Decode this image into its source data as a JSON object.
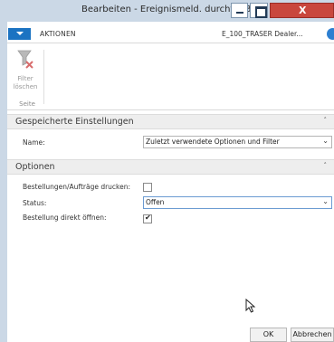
{
  "window": {
    "title": "Bearbeiten - Ereignismeld. durchf. - Best.",
    "close_glyph": "X"
  },
  "ribbon": {
    "tab_label": "AKTIONEN",
    "company": "E_100_TRASER Dealer...",
    "filter_button_label_line1": "Filter",
    "filter_button_label_line2": "löschen",
    "group_label": "Seite"
  },
  "sections": {
    "saved_settings": {
      "title": "Gespeicherte Einstellungen",
      "name_label": "Name:",
      "name_value": "Zuletzt verwendete Optionen und Filter"
    },
    "options": {
      "title": "Optionen",
      "print_label": "Bestellungen/Aufträge drucken:",
      "print_checked": false,
      "status_label": "Status:",
      "status_value": "Offen",
      "open_label": "Bestellung direkt öffnen:",
      "open_checked": true
    }
  },
  "footer": {
    "ok_label": "OK",
    "cancel_label": "Abbrechen"
  },
  "colors": {
    "titlebar": "#cbd8e6",
    "accent": "#1b73c2",
    "close": "#c9473d"
  },
  "icons": {
    "filter_clear": "filter-clear-icon",
    "collapse": "chevron-up-icon",
    "dropdown": "chevron-down-icon",
    "help": "help-icon"
  }
}
